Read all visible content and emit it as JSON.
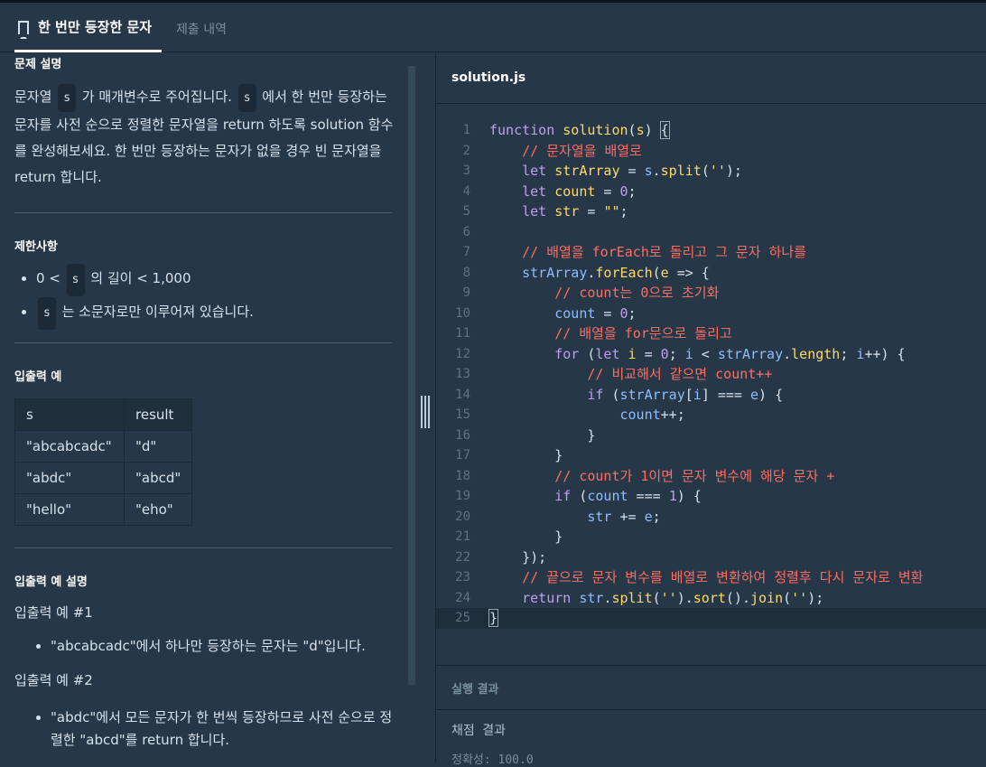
{
  "tabs": {
    "active": "한 번만 등장한 문자",
    "inactive": "제출 내역"
  },
  "problem": {
    "description_title": "문제 설명",
    "description": {
      "p1": "문자열",
      "s": "s",
      "p2": "가 매개변수로 주어집니다.",
      "p3": "에서 한 번만 등장하는 문자를 사전 순으로 정렬한 문자열을 return 하도록 solution 함수를 완성해보세요. 한 번만 등장하는 문자가 없을 경우 빈 문자열을 return 합니다."
    },
    "constraints_title": "제한사항",
    "constraints": {
      "c1_pre": "0 <",
      "c1_chip": "s",
      "c1_post": "의 길이 < 1,000",
      "c2_chip": "s",
      "c2_post": "는 소문자로만 이루어져 있습니다."
    },
    "io_title": "입출력 예",
    "io_table": {
      "headers": [
        "s",
        "result"
      ],
      "rows": [
        [
          "\"abcabcadc\"",
          "\"d\""
        ],
        [
          "\"abdc\"",
          "\"abcd\""
        ],
        [
          "\"hello\"",
          "\"eho\""
        ]
      ]
    },
    "io_explain_title": "입출력 예 설명",
    "examples": [
      {
        "title": "입출력 예 #1",
        "text": "\"abcabcadc\"에서 하나만 등장하는 문자는 \"d\"입니다."
      },
      {
        "title": "입출력 예 #2",
        "text": "\"abdc\"에서 모든 문자가 한 번씩 등장하므로 사전 순으로 정렬한 \"abcd\"를 return 합니다."
      }
    ]
  },
  "editor": {
    "filename": "solution.js",
    "line_numbers": [
      "1",
      "2",
      "3",
      "4",
      "5",
      "6",
      "7",
      "8",
      "9",
      "10",
      "11",
      "12",
      "13",
      "14",
      "15",
      "16",
      "17",
      "18",
      "19",
      "20",
      "21",
      "22",
      "23",
      "24",
      "25"
    ]
  },
  "result": {
    "header": "실행 결과",
    "grading": "채점 결과",
    "accuracy": "정확성: 100.0"
  }
}
